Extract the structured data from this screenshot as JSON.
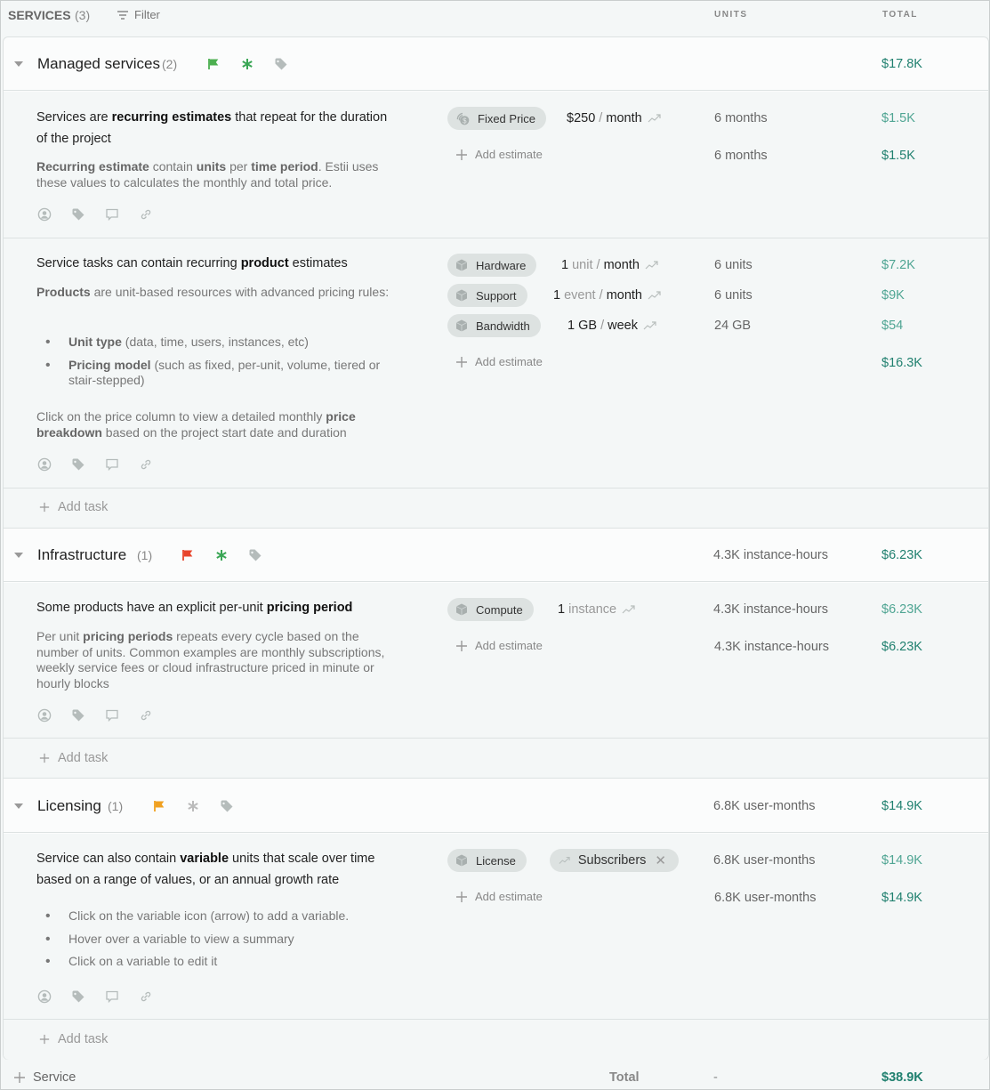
{
  "header": {
    "title": "SERVICES",
    "count": "(3)",
    "filter_label": "Filter",
    "col_units": "UNITS",
    "col_total": "TOTAL"
  },
  "colors": {
    "accent_green": "#4fa593",
    "accent_dark_green": "#20806f",
    "flag_green": "#4caf50",
    "flag_red": "#e8452c",
    "flag_orange": "#f0a020",
    "asterisk_green": "#3aa655",
    "asterisk_gray": "#bbbbbb"
  },
  "groups": [
    {
      "name": "Managed services",
      "count": "(2)",
      "flag_color": "green",
      "asterisk_active": true,
      "units": "",
      "total": "$17.8K",
      "tasks": [
        {
          "title_parts": [
            "Services are ",
            "recurring estimates",
            " that repeat for the duration of the project"
          ],
          "desc_parts": [
            "Recurring estimate",
            " contain ",
            "units",
            " per ",
            "time period",
            ". Estii uses these values to calculates the monthly and total price."
          ],
          "estimates": [
            {
              "chip": "Fixed Price",
              "chip_icon": "coins-icon",
              "amount": "$250",
              "unit": "",
              "period": "month",
              "units": "6 months",
              "total": "$1.5K"
            }
          ],
          "add_estimate": "Add estimate",
          "subtotal_units": "6 months",
          "subtotal": "$1.5K"
        },
        {
          "title_parts": [
            "Service tasks can contain recurring ",
            "product",
            " estimates"
          ],
          "desc_intro": [
            "Products",
            " are unit-based resources with advanced pricing rules:"
          ],
          "bullets": [
            {
              "bold": "Unit type",
              "text": " (data, time, users, instances, etc)"
            },
            {
              "bold": "Pricing model",
              "text": " (such as fixed, per-unit, volume, tiered or stair-stepped)"
            }
          ],
          "desc_outro": [
            "Click on the price column to view a detailed monthly ",
            "price breakdown",
            " based on the project start date and duration"
          ],
          "estimates": [
            {
              "chip": "Hardware",
              "chip_icon": "box-icon",
              "amount": "1",
              "unit": "unit",
              "period": "month",
              "units": "6 units",
              "total": "$7.2K"
            },
            {
              "chip": "Support",
              "chip_icon": "box-icon",
              "amount": "1",
              "unit": "event",
              "period": "month",
              "units": "6 units",
              "total": "$9K"
            },
            {
              "chip": "Bandwidth",
              "chip_icon": "box-icon",
              "amount": "1 GB",
              "unit": "",
              "period": "week",
              "units": "24 GB",
              "total": "$54"
            }
          ],
          "add_estimate": "Add estimate",
          "subtotal": "$16.3K"
        }
      ],
      "add_task": "Add task"
    },
    {
      "name": "Infrastructure",
      "count": "(1)",
      "flag_color": "red",
      "asterisk_active": true,
      "units": "4.3K instance-hours",
      "total": "$6.23K",
      "tasks": [
        {
          "title_parts": [
            "Some products have an explicit per-unit ",
            "pricing period",
            ""
          ],
          "desc_parts": [
            "Per unit ",
            "pricing periods",
            " repeats every cycle based on the number of units. Common examples are monthly subscriptions, weekly service fees or cloud infrastructure priced in minute or hourly blocks"
          ],
          "estimates": [
            {
              "chip": "Compute",
              "chip_icon": "box-icon",
              "amount": "1",
              "unit": "instance",
              "period": "",
              "units": "4.3K instance-hours",
              "total": "$6.23K"
            }
          ],
          "add_estimate": "Add estimate",
          "subtotal_units": "4.3K instance-hours",
          "subtotal": "$6.23K"
        }
      ],
      "add_task": "Add task"
    },
    {
      "name": "Licensing",
      "count": "(1)",
      "flag_color": "orange",
      "asterisk_active": false,
      "units": "6.8K user-months",
      "total": "$14.9K",
      "tasks": [
        {
          "title_parts": [
            "Service can also contain ",
            "variable",
            " units that scale over time based on a range of values, or an annual growth rate"
          ],
          "bullets": [
            "Click on the variable icon (arrow) to add a variable.",
            "Hover over a variable to view a summary",
            "Click on a variable to edit it"
          ],
          "estimates": [
            {
              "chip": "License",
              "chip_icon": "box-icon",
              "variable": "Subscribers",
              "units": "6.8K user-months",
              "total": "$14.9K"
            }
          ],
          "add_estimate": "Add estimate",
          "subtotal_units": "6.8K user-months",
          "subtotal": "$14.9K"
        }
      ],
      "add_task": "Add task"
    }
  ],
  "footer": {
    "add_service": "Service",
    "total_label": "Total",
    "total_units": "-",
    "total": "$38.9K"
  }
}
